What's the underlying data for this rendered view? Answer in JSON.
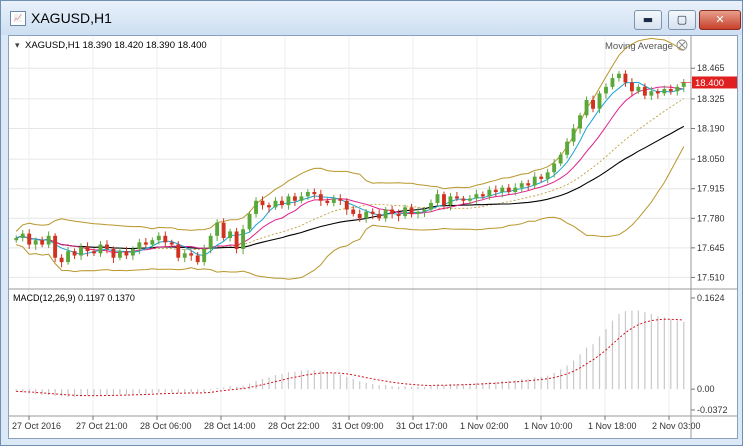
{
  "window": {
    "title": "XAGUSD,H1",
    "minimize_glyph": "▬",
    "maximize_glyph": "▢",
    "close_glyph": "✕"
  },
  "colors": {
    "bull": "#5aa83a",
    "bear": "#d0321f",
    "bollinger": "#b8962a",
    "ma_fast": "#1aa3d8",
    "ma_mid": "#e0208c",
    "ma_slow": "#000000",
    "macd_hist": "#c8c8c8",
    "macd_signal": "#d0101e",
    "price_tag": "#e02020"
  },
  "chart_data": [
    {
      "type": "candlestick",
      "header": "XAGUSD,H1  18.390 18.420 18.390 18.400",
      "indicator_label": "Moving Average",
      "current_price": "18.400",
      "y_ticks": [
        "18.465",
        "18.325",
        "18.190",
        "18.050",
        "17.915",
        "17.780",
        "17.645",
        "17.510"
      ],
      "ylim": [
        17.48,
        18.53
      ],
      "x_labels": [
        "27 Oct 2016",
        "27 Oct 21:00",
        "28 Oct 06:00",
        "28 Oct 14:00",
        "28 Oct 22:00",
        "31 Oct 09:00",
        "31 Oct 17:00",
        "1 Nov 02:00",
        "1 Nov 10:00",
        "1 Nov 18:00",
        "2 Nov 03:00"
      ],
      "close": [
        17.69,
        17.71,
        17.66,
        17.68,
        17.66,
        17.7,
        17.6,
        17.58,
        17.63,
        17.61,
        17.65,
        17.63,
        17.62,
        17.66,
        17.64,
        17.6,
        17.63,
        17.61,
        17.64,
        17.67,
        17.66,
        17.68,
        17.7,
        17.67,
        17.66,
        17.6,
        17.62,
        17.61,
        17.58,
        17.64,
        17.7,
        17.76,
        17.69,
        17.72,
        17.64,
        17.73,
        17.8,
        17.86,
        17.84,
        17.83,
        17.86,
        17.84,
        17.88,
        17.86,
        17.88,
        17.9,
        17.89,
        17.86,
        17.85,
        17.87,
        17.86,
        17.82,
        17.8,
        17.78,
        17.81,
        17.8,
        17.78,
        17.82,
        17.8,
        17.79,
        17.83,
        17.8,
        17.81,
        17.82,
        17.85,
        17.89,
        17.84,
        17.88,
        17.87,
        17.86,
        17.87,
        17.89,
        17.88,
        17.91,
        17.9,
        17.92,
        17.9,
        17.92,
        17.94,
        17.93,
        17.97,
        17.96,
        17.99,
        18.03,
        18.07,
        18.13,
        18.19,
        18.25,
        18.32,
        18.28,
        18.35,
        18.38,
        18.42,
        18.44,
        18.4,
        18.36,
        18.38,
        18.34,
        18.36,
        18.35,
        18.37,
        18.36,
        18.38,
        18.4
      ],
      "macd_ylim": [
        -0.0372,
        0.1624
      ],
      "macd_label": "MACD(12,26,9) 0.1197 0.1370",
      "macd_ticks": [
        "0.1624",
        "0.00",
        "-0.0372"
      ],
      "macd_hist": [
        -0.004,
        -0.006,
        -0.008,
        -0.009,
        -0.01,
        -0.011,
        -0.012,
        -0.013,
        -0.014,
        -0.014,
        -0.013,
        -0.012,
        -0.012,
        -0.011,
        -0.011,
        -0.01,
        -0.01,
        -0.01,
        -0.009,
        -0.008,
        -0.008,
        -0.007,
        -0.006,
        -0.006,
        -0.006,
        -0.007,
        -0.006,
        -0.006,
        -0.007,
        -0.005,
        -0.002,
        0.002,
        0.003,
        0.005,
        0.004,
        0.006,
        0.01,
        0.015,
        0.018,
        0.021,
        0.025,
        0.027,
        0.03,
        0.031,
        0.033,
        0.034,
        0.034,
        0.033,
        0.031,
        0.029,
        0.026,
        0.022,
        0.018,
        0.014,
        0.011,
        0.009,
        0.007,
        0.007,
        0.005,
        0.004,
        0.005,
        0.004,
        0.004,
        0.004,
        0.005,
        0.008,
        0.007,
        0.009,
        0.009,
        0.009,
        0.01,
        0.011,
        0.011,
        0.013,
        0.013,
        0.015,
        0.015,
        0.016,
        0.018,
        0.018,
        0.021,
        0.022,
        0.024,
        0.029,
        0.035,
        0.042,
        0.051,
        0.062,
        0.074,
        0.08,
        0.094,
        0.107,
        0.122,
        0.134,
        0.139,
        0.14,
        0.14,
        0.137,
        0.134,
        0.13,
        0.128,
        0.124,
        0.122,
        0.12
      ]
    }
  ]
}
